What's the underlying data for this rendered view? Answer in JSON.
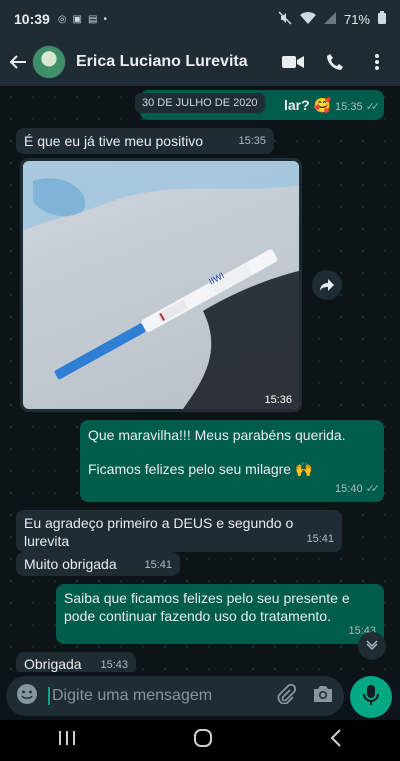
{
  "status_bar": {
    "time": "10:39",
    "battery": "71%"
  },
  "header": {
    "contact_name": "Erica Luciano Lurevita"
  },
  "chat": {
    "date_chip": "30 DE JULHO DE 2020",
    "messages": [
      {
        "direction": "out",
        "text": "lar? 🥰",
        "time": "15:35",
        "read": true
      },
      {
        "direction": "in",
        "text": "É que eu já tive meu positivo",
        "time": "15:35"
      },
      {
        "direction": "in",
        "type": "image",
        "time": "15:36"
      },
      {
        "direction": "out",
        "text": "Que maravilha!!! Meus parabéns querida.",
        "text2": "Ficamos felizes pelo seu milagre 🙌",
        "time": "15:40",
        "read": true
      },
      {
        "direction": "in",
        "text": "Eu agradeço primeiro a DEUS e segundo o lurevita",
        "time": "15:41"
      },
      {
        "direction": "in",
        "text": "Muito obrigada",
        "time": "15:41"
      },
      {
        "direction": "out",
        "text": "Saiba que ficamos felizes pelo seu presente e pode continuar fazendo uso do tratamento.",
        "time": "15:43"
      },
      {
        "direction": "in",
        "text": "Obrigada",
        "time": "15:43"
      }
    ],
    "image_test_mark": "IIWI"
  },
  "composer": {
    "placeholder": "Digite uma mensagem"
  },
  "colors": {
    "incoming_bubble": "#202c33",
    "outgoing_bubble": "#005c4b",
    "accent": "#00a884",
    "header_bg": "#1f2c34"
  },
  "icons": [
    "back-arrow-icon",
    "video-call-icon",
    "phone-icon",
    "more-icon",
    "share-icon",
    "chevron-down-icon",
    "emoji-icon",
    "attach-icon",
    "camera-icon",
    "mic-icon",
    "nav-recents-icon",
    "nav-home-icon",
    "nav-back-icon"
  ]
}
